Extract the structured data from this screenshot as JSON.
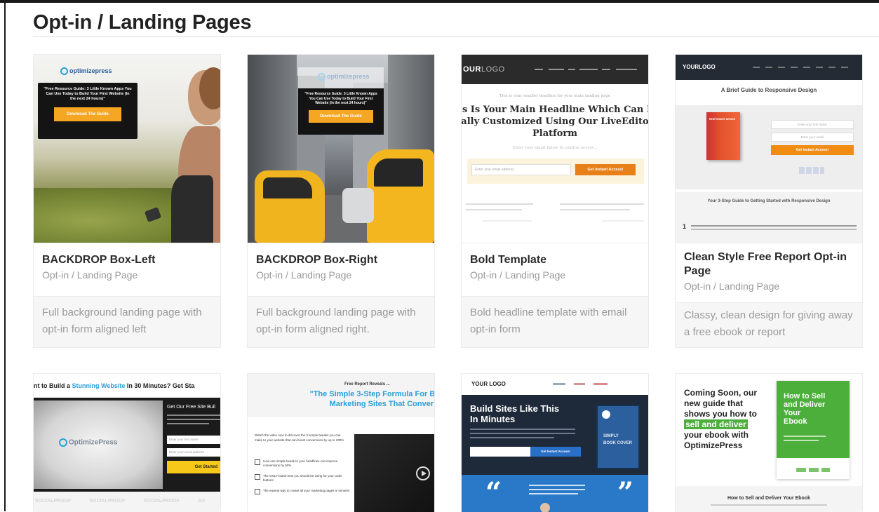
{
  "page": {
    "title": "Opt-in / Landing Pages"
  },
  "templates": [
    {
      "title": "BACKDROP Box-Left",
      "category": "Opt-in / Landing Page",
      "description": "Full background landing page with opt-in form aligned left",
      "thumb": {
        "logo": "optimizepress",
        "headline": "\"Free Resource Guide: 3 Little Known Apps You Can Use Today to Build Your First Website (In the next 24 hours)\"",
        "button": "Download The Guide"
      }
    },
    {
      "title": "BACKDROP Box-Right",
      "category": "Opt-in / Landing Page",
      "description": "Full background landing page with opt-in form aligned right.",
      "thumb": {
        "logo": "optimizepress",
        "headline": "\"Free Resource Guide: 3 Little Known Apps You Can Use Today to Build Your First Website (In the next 24 hours)\"",
        "button": "Download The Guide"
      }
    },
    {
      "title": "Bold Template",
      "category": "Opt-in / Landing Page",
      "description": "Bold headline template with email opt-in form",
      "thumb": {
        "logo_a": "OUR",
        "logo_b": "LOGO",
        "subheadline": "This is your smaller headline for your main landing page",
        "headline": "is Is Your Main Headline Which Can I ally Customized Using Our LiveEdito Platform",
        "prompt": "Enter your email below to confirm access...",
        "input_placeholder": "Enter your email address",
        "button": "Get Instant Access!"
      }
    },
    {
      "title": "Clean Style Free Report Opt-in Page",
      "category": "Opt-in / Landing Page",
      "description": "Classy, clean design for giving away a free ebook or report",
      "thumb": {
        "logo": "YOURLOGO",
        "headline": "A Brief Guide to Responsive Design",
        "book_title": "RESPONSIVE DESIGN",
        "input_a": "Enter your first name",
        "input_b": "Enter your email",
        "button": "Get Instant Access!",
        "section_title": "Your 3-Step Guide to Getting Started with Responsive Design",
        "step_number": "1"
      }
    },
    {
      "thumb": {
        "headline_pre": "nt to Build a ",
        "headline_accent": "Stunning Website",
        "headline_post": " In 30 Minutes? Get Sta",
        "logo": "OptimizePress",
        "form_title": "Get Our Free Site Buil",
        "input_a": "Enter your first name",
        "input_b": "Enter your email address",
        "button": "Get Started",
        "social": [
          "SOCIALPROOF",
          "SOCIALPROOF",
          "SOCIALPROOF",
          "SO"
        ]
      }
    },
    {
      "thumb": {
        "kicker": "Free Report Reveals ...",
        "headline": "\"The Simple 3-Step Formula For Bu Marketing Sites That Convert\"",
        "intro": "Watch the video now to discover the 3 simple tweaks you can make to your website that can boost conversions by up to 200%",
        "bullets": [
          "How one simple tweak to your headlines can improve conversions by 50%",
          "The ONLY button text you should be using for your order buttons",
          "The easiest way to create all your marketing pages in minutes"
        ]
      }
    },
    {
      "thumb": {
        "logo": "YOUR LOGO",
        "headline": "Build Sites Like This In Minutes",
        "button": "Get Instant Access!",
        "book_line_a": "SIMPLY",
        "book_line_b": "BOOK COVER",
        "quote_open": "“",
        "quote_close": "”"
      }
    },
    {
      "thumb": {
        "line1": "Coming Soon, our",
        "line2": "new guide that",
        "line3": "shows you how to",
        "highlight": "sell and deliver",
        "line5": "your ebook with",
        "line6": "OptimizePress",
        "book_title": "How to Sell and Deliver Your Ebook",
        "footer_title": "How to Sell and Deliver Your Ebook"
      }
    }
  ],
  "colors": {
    "accent_orange": "#f5a623",
    "accent_blue": "#2a9fd8",
    "dark_navy": "#1e2a3a",
    "green": "#4caf3c"
  }
}
